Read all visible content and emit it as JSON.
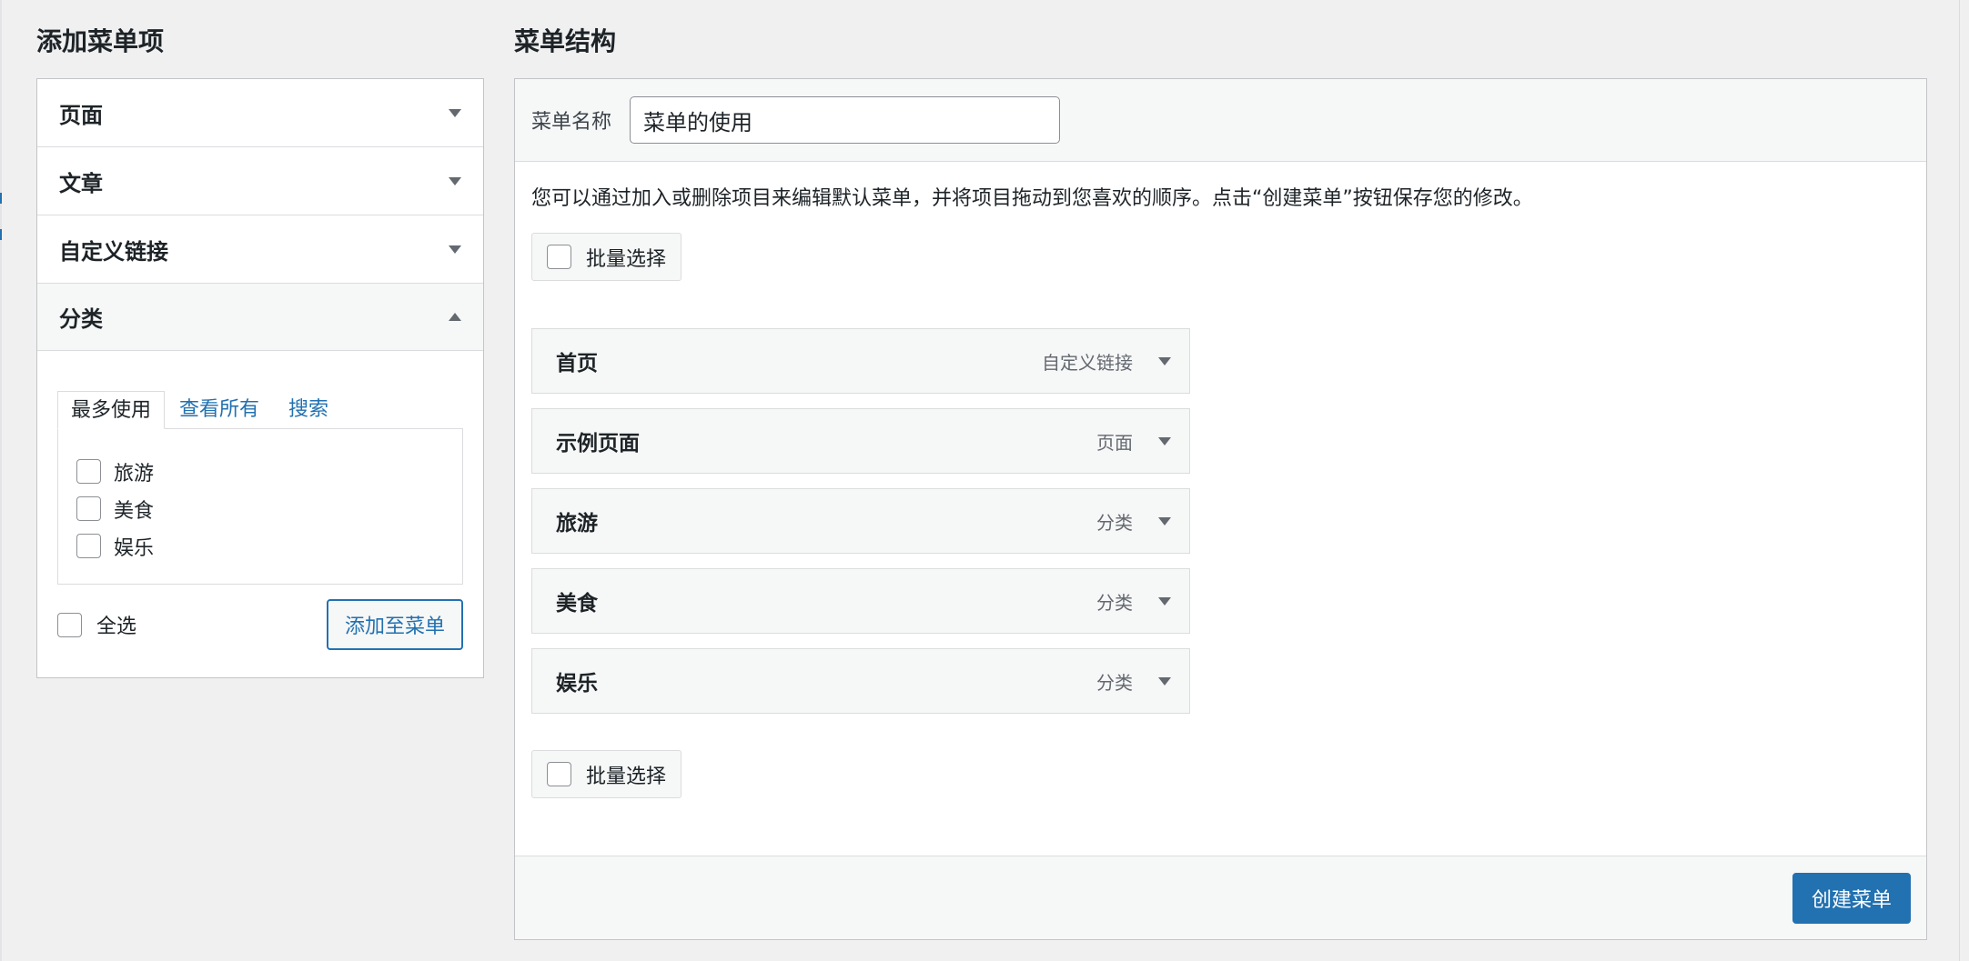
{
  "left_panel": {
    "title": "添加菜单项",
    "sections": [
      {
        "label": "页面"
      },
      {
        "label": "文章"
      },
      {
        "label": "自定义链接"
      },
      {
        "label": "分类"
      }
    ],
    "tabs": [
      {
        "label": "最多使用"
      },
      {
        "label": "查看所有"
      },
      {
        "label": "搜索"
      }
    ],
    "categories": [
      {
        "label": "旅游"
      },
      {
        "label": "美食"
      },
      {
        "label": "娱乐"
      }
    ],
    "select_all_label": "全选",
    "add_button_label": "添加至菜单"
  },
  "right_panel": {
    "title": "菜单结构",
    "menu_name_label": "菜单名称",
    "menu_name_value": "菜单的使用",
    "description": "您可以通过加入或删除项目来编辑默认菜单，并将项目拖动到您喜欢的顺序。点击“创建菜单”按钮保存您的修改。",
    "bulk_select_label": "批量选择",
    "items": [
      {
        "title": "首页",
        "type": "自定义链接"
      },
      {
        "title": "示例页面",
        "type": "页面"
      },
      {
        "title": "旅游",
        "type": "分类"
      },
      {
        "title": "美食",
        "type": "分类"
      },
      {
        "title": "娱乐",
        "type": "分类"
      }
    ],
    "create_button_label": "创建菜单"
  },
  "colors": {
    "accent": "#2271b1",
    "background": "#f0f0f1",
    "border": "#c3c4c7"
  }
}
